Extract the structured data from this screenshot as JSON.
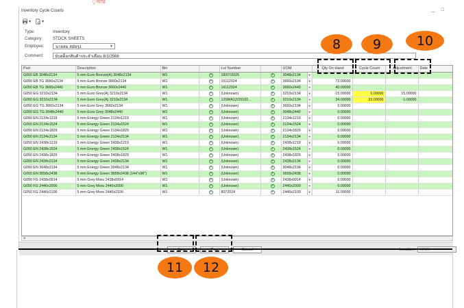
{
  "window": {
    "title": "Inventory Cycle Counts",
    "top_red_text": "ৃজান্ত"
  },
  "toolbar": {
    "print_icon": "printer-icon",
    "export_icon": "document-icon"
  },
  "form": {
    "type_label": "Type:",
    "type_value": "Inventory",
    "category_label": "Category:",
    "category_value": "STOCK SHEETS",
    "employee_label": "Employee:",
    "employee_value": "นายสม สมัยรุ่ง",
    "comment_label": "Comment:",
    "comment_value": "นับสต็อกสินค้าประจำเดือน 8/1/2568"
  },
  "grid": {
    "columns": [
      "Part",
      "Description",
      "Bin",
      "",
      "Lot Number",
      "",
      "UOM",
      "Qty On Hand",
      "Cycle Count",
      "Adjustment",
      "Date"
    ],
    "rows": [
      {
        "style": "g",
        "part": "G050 EB 3048x2134",
        "desc": "5 mm Euro Bronze(A) 3048x2134",
        "bin": "W1",
        "lot": "18/07/2025",
        "uom": "3048x2134",
        "qoh": "",
        "cc": "",
        "adj": "",
        "ylw": false
      },
      {
        "style": "w",
        "part": "G050 EB TG 3660x2134",
        "desc": "5 mm Euro Bronze 3660x2134",
        "bin": "W1",
        "lot": "15112024",
        "uom": "3660x2134",
        "qoh": "72.00000",
        "cc": "",
        "adj": "",
        "ylw": false
      },
      {
        "style": "g",
        "part": "G050 EB TG 3660x2440",
        "desc": "5 mm Euro Bronze 3660x2440",
        "bin": "W1",
        "lot": "16112024",
        "uom": "3660x2440",
        "qoh": "40.00000",
        "cc": "",
        "adj": "",
        "ylw": false
      },
      {
        "style": "w",
        "part": "G050 EG 3210x2134",
        "desc": "5 mm Euro Grey(A) 3210x2134",
        "bin": "W1",
        "lot": "(Unknown)",
        "uom": "3210x2134",
        "qoh": "-15.00000",
        "cc": "0.00000",
        "adj": "15.00000",
        "ylw": true
      },
      {
        "style": "g",
        "part": "G050 EG 3210x2134",
        "desc": "5 mm Euro Grey(A) 3210x2134",
        "bin": "W1",
        "lot": "12SMA1Z/25102...",
        "uom": "3210x2134",
        "qoh": "34.00000",
        "cc": "33.00000",
        "adj": "-1.00000",
        "ylw": true
      },
      {
        "style": "w",
        "part": "G050 EG TG 3660x2134",
        "desc": "5 mm Euro Grey 3660x2134",
        "bin": "W1",
        "lot": "(Unknown)",
        "uom": "3660x2134",
        "qoh": "0.00000",
        "cc": "",
        "adj": "",
        "ylw": false
      },
      {
        "style": "g",
        "part": "G050 EG TG 3048x2440",
        "desc": "5 mm Euro Grey 3048x2440",
        "bin": "W1",
        "lot": "(Unknown)",
        "uom": "3048x2440",
        "qoh": "0.00000",
        "cc": "",
        "adj": "",
        "ylw": false,
        "tick": true
      },
      {
        "style": "w",
        "part": "G050 EN 2134x1219",
        "desc": "5 mm Energy Green 2134x1219",
        "bin": "W1",
        "lot": "(Unknown)",
        "uom": "2134x1219",
        "qoh": "0.00000",
        "cc": "",
        "adj": "",
        "ylw": false
      },
      {
        "style": "g",
        "part": "G050 EN 2134x1524",
        "desc": "5 mm Energy Green 2134x1524",
        "bin": "W1",
        "lot": "(Unknown)",
        "uom": "2134x1524",
        "qoh": "0.00000",
        "cc": "",
        "adj": "",
        "ylw": false
      },
      {
        "style": "w",
        "part": "G050 EN 2134x1829",
        "desc": "5 mm Energy Green 2134x1829",
        "bin": "W1",
        "lot": "(Unknown)",
        "uom": "2134x1829",
        "qoh": "0.00000",
        "cc": "",
        "adj": "",
        "ylw": false
      },
      {
        "style": "g",
        "part": "G050 EN 2134x2134",
        "desc": "5 mm Energy Green 2134x2134",
        "bin": "W1",
        "lot": "(Unknown)",
        "uom": "2134x2134",
        "qoh": "0.00000",
        "cc": "",
        "adj": "",
        "ylw": false
      },
      {
        "style": "w",
        "part": "G050 EN 2438x1219",
        "desc": "5 mm Energy Green 2438x1219",
        "bin": "W1",
        "lot": "(Unknown)",
        "uom": "2438x1219",
        "qoh": "0.00000",
        "cc": "",
        "adj": "",
        "ylw": false
      },
      {
        "style": "g",
        "part": "G050 EN 2438x1524",
        "desc": "5 mm Energy Green 2438x1524",
        "bin": "W1",
        "lot": "(Unknown)",
        "uom": "2438x1524",
        "qoh": "0.00000",
        "cc": "",
        "adj": "",
        "ylw": false
      },
      {
        "style": "w",
        "part": "G050 EN 2438x1829",
        "desc": "5 mm Energy Green 2438x1829",
        "bin": "W1",
        "lot": "(Unknown)",
        "uom": "2438x1829",
        "qoh": "0.00000",
        "cc": "",
        "adj": "",
        "ylw": false
      },
      {
        "style": "g",
        "part": "G050 EN 2438x2134",
        "desc": "5 mm Energy Green 2438x2134",
        "bin": "W1",
        "lot": "(Unknown)",
        "uom": "2438x2134",
        "qoh": "0.00000",
        "cc": "",
        "adj": "",
        "ylw": false
      },
      {
        "style": "w",
        "part": "G050 EN 3048x2134",
        "desc": "5 mm Energy Green 3048x2134",
        "bin": "W1",
        "lot": "(Unknown)",
        "uom": "3048x2134",
        "qoh": "0.00000",
        "cc": "",
        "adj": "",
        "ylw": false
      },
      {
        "style": "g",
        "part": "G050 EN 3658x2438",
        "desc": "5 mm Energy Green 3658x2438 (144\"x96\")",
        "bin": "W1",
        "lot": "(Unknown)",
        "uom": "3658x2438",
        "qoh": "0.00000",
        "cc": "",
        "adj": "",
        "ylw": false
      },
      {
        "style": "w",
        "part": "G050 FG 2438x0914",
        "desc": "5 mm Grey Moru 2438x0914",
        "bin": "W1",
        "lot": "(Unknown)",
        "uom": "2438x0914",
        "qoh": "0.00000",
        "cc": "",
        "adj": "",
        "ylw": false
      },
      {
        "style": "g",
        "part": "G050 FG 2440x2000",
        "desc": "5 mm Grey Moru 2440x2000",
        "bin": "W1",
        "lot": "(Unknown)",
        "uom": "2440x2000",
        "qoh": "0.00000",
        "cc": "",
        "adj": "",
        "ylw": false
      },
      {
        "style": "w",
        "part": "G050 FG 2440x2100",
        "desc": "5 mm Grey Moru 2440x2100",
        "bin": "W1",
        "lot": "8072024",
        "uom": "2440x2100",
        "qoh": "11.00000",
        "cc": "",
        "adj": "",
        "ylw": false
      }
    ]
  },
  "buttons": {
    "save": "Save",
    "post": "Post",
    "cancel": "Cancel"
  },
  "location": {
    "label": "Location:",
    "value": "MAIN"
  },
  "callouts": {
    "qoh": "8",
    "cc": "9",
    "adj": "10",
    "save": "11",
    "post": "12"
  },
  "colors": {
    "callout": "#f47814",
    "row_green": "#c8f5c0",
    "highlight": "#ffff44"
  }
}
